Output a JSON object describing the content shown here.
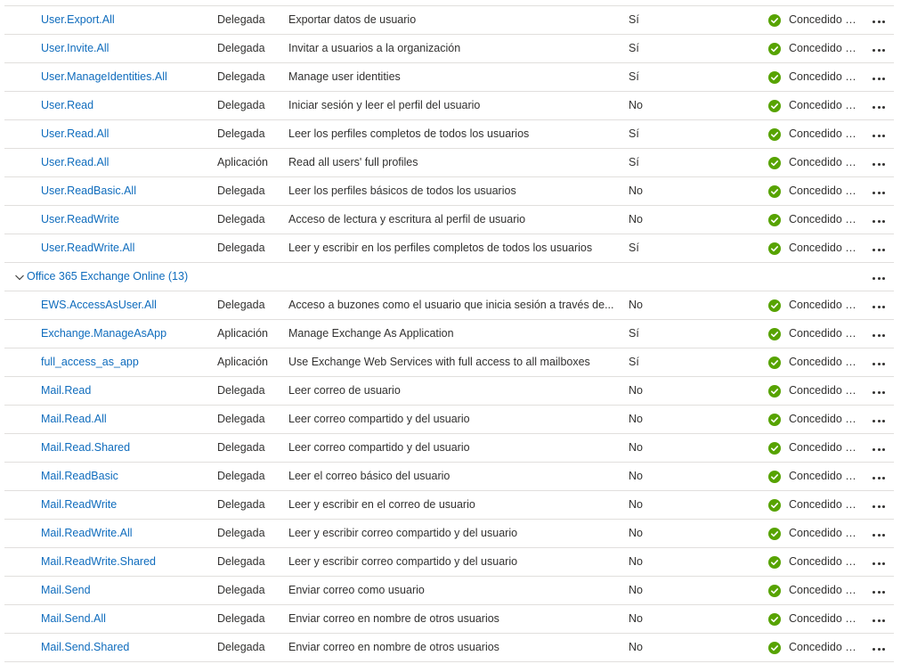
{
  "status_color": "#57a300",
  "link_color": "#0f6cbd",
  "rows_before": [
    {
      "name": "User.Export.All",
      "type": "Delegada",
      "description": "Exportar datos de usuario",
      "admin": "Sí",
      "status": "Concedido p..."
    },
    {
      "name": "User.Invite.All",
      "type": "Delegada",
      "description": "Invitar a usuarios a la organización",
      "admin": "Sí",
      "status": "Concedido p..."
    },
    {
      "name": "User.ManageIdentities.All",
      "type": "Delegada",
      "description": "Manage user identities",
      "admin": "Sí",
      "status": "Concedido p..."
    },
    {
      "name": "User.Read",
      "type": "Delegada",
      "description": "Iniciar sesión y leer el perfil del usuario",
      "admin": "No",
      "status": "Concedido p..."
    },
    {
      "name": "User.Read.All",
      "type": "Delegada",
      "description": "Leer los perfiles completos de todos los usuarios",
      "admin": "Sí",
      "status": "Concedido p..."
    },
    {
      "name": "User.Read.All",
      "type": "Aplicación",
      "description": "Read all users' full profiles",
      "admin": "Sí",
      "status": "Concedido p..."
    },
    {
      "name": "User.ReadBasic.All",
      "type": "Delegada",
      "description": "Leer los perfiles básicos de todos los usuarios",
      "admin": "No",
      "status": "Concedido p..."
    },
    {
      "name": "User.ReadWrite",
      "type": "Delegada",
      "description": "Acceso de lectura y escritura al perfil de usuario",
      "admin": "No",
      "status": "Concedido p..."
    },
    {
      "name": "User.ReadWrite.All",
      "type": "Delegada",
      "description": "Leer y escribir en los perfiles completos de todos los usuarios",
      "admin": "Sí",
      "status": "Concedido p..."
    }
  ],
  "group": {
    "label": "Office 365 Exchange Online (13)",
    "expanded": true
  },
  "rows_after": [
    {
      "name": "EWS.AccessAsUser.All",
      "type": "Delegada",
      "description": "Acceso a buzones como el usuario que inicia sesión a través de...",
      "admin": "No",
      "status": "Concedido p..."
    },
    {
      "name": "Exchange.ManageAsApp",
      "type": "Aplicación",
      "description": "Manage Exchange As Application",
      "admin": "Sí",
      "status": "Concedido p..."
    },
    {
      "name": "full_access_as_app",
      "type": "Aplicación",
      "description": "Use Exchange Web Services with full access to all mailboxes",
      "admin": "Sí",
      "status": "Concedido p..."
    },
    {
      "name": "Mail.Read",
      "type": "Delegada",
      "description": "Leer correo de usuario",
      "admin": "No",
      "status": "Concedido p..."
    },
    {
      "name": "Mail.Read.All",
      "type": "Delegada",
      "description": "Leer correo compartido y del usuario",
      "admin": "No",
      "status": "Concedido p..."
    },
    {
      "name": "Mail.Read.Shared",
      "type": "Delegada",
      "description": "Leer correo compartido y del usuario",
      "admin": "No",
      "status": "Concedido p..."
    },
    {
      "name": "Mail.ReadBasic",
      "type": "Delegada",
      "description": "Leer el correo básico del usuario",
      "admin": "No",
      "status": "Concedido p..."
    },
    {
      "name": "Mail.ReadWrite",
      "type": "Delegada",
      "description": "Leer y escribir en el correo de usuario",
      "admin": "No",
      "status": "Concedido p..."
    },
    {
      "name": "Mail.ReadWrite.All",
      "type": "Delegada",
      "description": "Leer y escribir correo compartido y del usuario",
      "admin": "No",
      "status": "Concedido p..."
    },
    {
      "name": "Mail.ReadWrite.Shared",
      "type": "Delegada",
      "description": "Leer y escribir correo compartido y del usuario",
      "admin": "No",
      "status": "Concedido p..."
    },
    {
      "name": "Mail.Send",
      "type": "Delegada",
      "description": "Enviar correo como usuario",
      "admin": "No",
      "status": "Concedido p..."
    },
    {
      "name": "Mail.Send.All",
      "type": "Delegada",
      "description": "Enviar correo en nombre de otros usuarios",
      "admin": "No",
      "status": "Concedido p..."
    },
    {
      "name": "Mail.Send.Shared",
      "type": "Delegada",
      "description": "Enviar correo en nombre de otros usuarios",
      "admin": "No",
      "status": "Concedido p..."
    }
  ]
}
